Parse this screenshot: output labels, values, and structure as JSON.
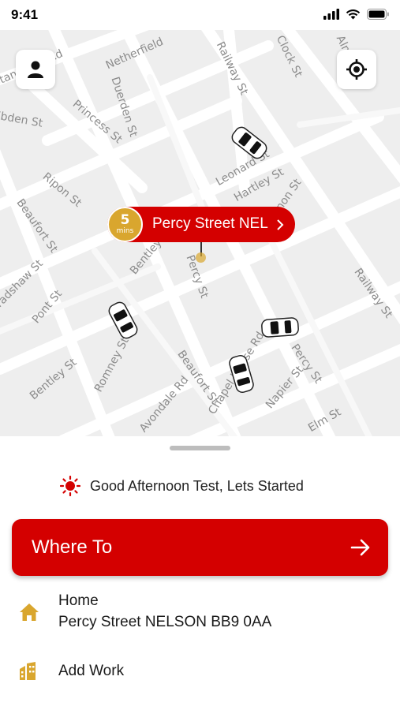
{
  "status_bar": {
    "time": "9:41",
    "icons": [
      "cellular-signal-icon",
      "wifi-icon",
      "battery-icon"
    ]
  },
  "map": {
    "streets": [
      "Stanworth Rd",
      "Netherfield",
      "Railway St",
      "Clock St",
      "Alma Rd",
      "Ebden St",
      "Duerden St",
      "Princess St",
      "Leonard St",
      "Hartley St",
      "Vernon St",
      "Ripon St",
      "Beaufort St",
      "Bentley St",
      "Percy St",
      "Bradshaw St",
      "Pont St",
      "Railway St",
      "Romney St",
      "Beaufort St",
      "Chapel House Rd",
      "Percy St",
      "Napier St",
      "Bentley St",
      "Avondale Rd",
      "Elm St"
    ],
    "pickup": {
      "eta_value": "5",
      "eta_unit": "mins",
      "label": "Percy Street NEL"
    }
  },
  "greeting": "Good Afternoon Test, Lets Started",
  "where_to": "Where To",
  "places": [
    {
      "title": "Home",
      "subtitle": "Percy Street NELSON BB9 0AA",
      "icon": "home-icon"
    },
    {
      "title": "Add Work",
      "icon": "work-building-icon"
    }
  ],
  "colors": {
    "brand_red": "#d40000",
    "accent_gold": "#d9a62e",
    "map_background": "#eeeeee"
  }
}
